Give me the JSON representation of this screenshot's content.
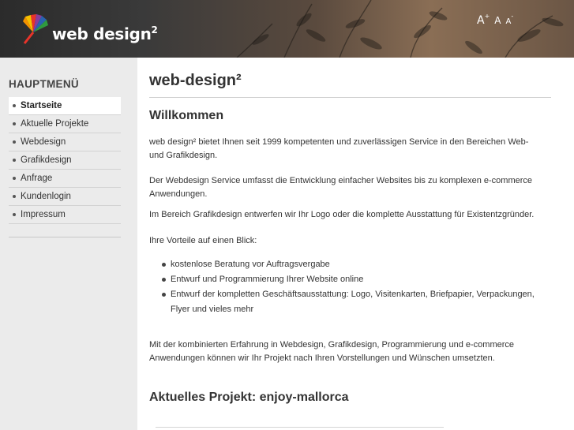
{
  "header": {
    "logo_text": "web design",
    "logo_sup": "2",
    "font_controls": {
      "large": "A",
      "large_sup": "+",
      "normal": "A",
      "small": "A",
      "small_sup": "-"
    },
    "logo_colors": [
      "#e8332a",
      "#f7c100",
      "#2f9a3f",
      "#2a62b0",
      "#8a3c9c"
    ]
  },
  "sidebar": {
    "title": "HAUPTMENÜ",
    "items": [
      {
        "label": "Startseite",
        "active": true
      },
      {
        "label": "Aktuelle Projekte",
        "active": false
      },
      {
        "label": "Webdesign",
        "active": false
      },
      {
        "label": "Grafikdesign",
        "active": false
      },
      {
        "label": "Anfrage",
        "active": false
      },
      {
        "label": "Kundenlogin",
        "active": false
      },
      {
        "label": "Impressum",
        "active": false
      }
    ]
  },
  "main": {
    "title": "web-design²",
    "welcome_heading": "Willkommen",
    "paragraphs": [
      "web design² bietet Ihnen seit 1999 kompetenten und zuverlässigen Service in den Bereichen Web- und Grafikdesign.",
      "Der Webdesign Service umfasst die Entwicklung einfacher Websites bis zu komplexen e-commerce Anwendungen.",
      "Im Bereich Grafikdesign entwerfen wir Ihr Logo oder die komplette Ausstattung für Existentzgründer.",
      "Ihre Vorteile auf einen Blick:"
    ],
    "benefits": [
      "kostenlose Beratung vor Auftragsvergabe",
      "Entwurf und Programmierung Ihrer Website online",
      "Entwurf der kompletten Geschäftsausstattung: Logo, Visitenkarten, Briefpapier, Verpackungen, Flyer und vieles mehr"
    ],
    "closing": "Mit der kombinierten Erfahrung in Webdesign, Grafikdesign, Programmierung und e-commerce Anwendungen können wir Ihr Projekt nach Ihren Vorstellungen und Wünschen umsetzten.",
    "project_heading": "Aktuelles Projekt: enjoy-mallorca"
  }
}
